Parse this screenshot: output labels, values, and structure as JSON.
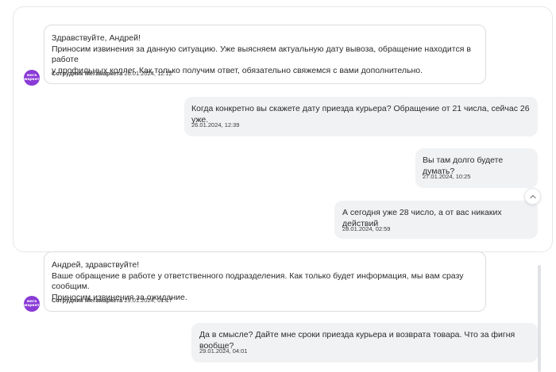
{
  "messages": [
    {
      "direction": "in",
      "text": "Здравствуйте, Андрей!\nПриносим извинения за данную ситуацию. Уже выясняем актуальную дату вывоза, обращение находится в работе\nу профильных коллег. Как только получим ответ, обязательно свяжемся с вами дополнительно.",
      "sender": "Сотрудник Мегамаркета",
      "time": "26.01.2024, 12:12"
    },
    {
      "direction": "out",
      "text": "Когда конкретно вы скажете дату приезда курьера? Обращение от 21 числа, сейчас 26 уже.",
      "time": "26.01.2024, 12:39"
    },
    {
      "direction": "out",
      "text": "Вы там долго будете думать?",
      "time": "27.01.2024, 10:25"
    },
    {
      "direction": "out",
      "text": "А сегодня уже 28 число, а от вас никаких действий",
      "time": "28.01.2024, 02:59"
    },
    {
      "direction": "in",
      "text": "Андрей, здравствуйте!\nВаше обращение в работе у ответственного подразделения. Как только будет информация, мы вам сразу сообщим.\nПриносим извинения за ожидание.",
      "sender": "Сотрудник Мегамаркета",
      "time": "29.01.2024, 01:17"
    },
    {
      "direction": "out",
      "text": "Да в смысле? Дайте мне сроки приезда курьера и возврата товара. Что за фигня вообще?",
      "time": "29.01.2024, 04:01"
    }
  ],
  "avatar": {
    "line1": "мега",
    "line2": "маркет",
    "color": "#8a3bd6"
  },
  "icons": {
    "scroll_up": "chevron-up-icon"
  }
}
